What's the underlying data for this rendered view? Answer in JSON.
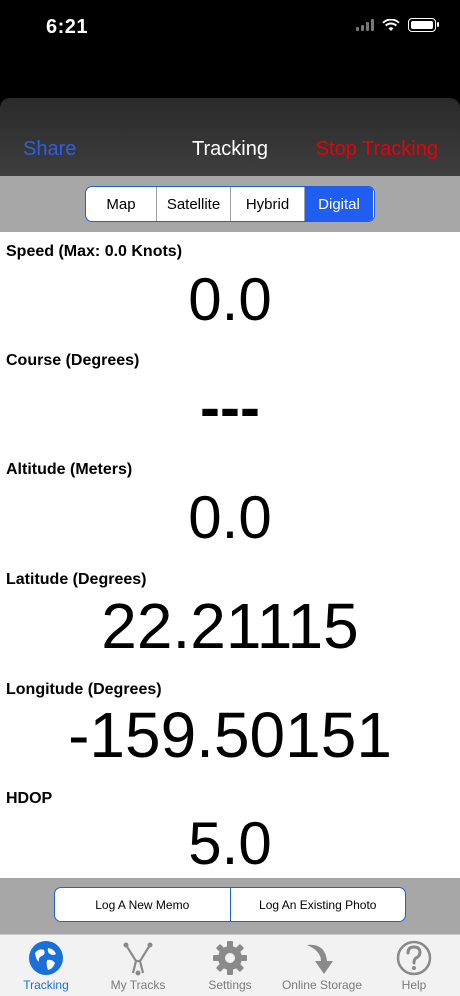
{
  "status_bar": {
    "time": "6:21"
  },
  "nav": {
    "left": "Share",
    "title": "Tracking",
    "right": "Stop Tracking"
  },
  "segments": [
    "Map",
    "Satellite",
    "Hybrid",
    "Digital"
  ],
  "selected_segment": "Digital",
  "readouts": [
    {
      "label": "Speed (Max: 0.0 Knots)",
      "value": "0.0"
    },
    {
      "label": "Course (Degrees)",
      "value": "---"
    },
    {
      "label": "Altitude (Meters)",
      "value": "0.0"
    },
    {
      "label": "Latitude (Degrees)",
      "value": "22.21115"
    },
    {
      "label": "Longitude (Degrees)",
      "value": "-159.50151"
    },
    {
      "label": "HDOP",
      "value": "5.0"
    }
  ],
  "memo": {
    "new_memo": "Log A New Memo",
    "existing_photo": "Log An Existing Photo"
  },
  "tabs": [
    {
      "label": "Tracking",
      "icon": "globe-icon"
    },
    {
      "label": "My Tracks",
      "icon": "tracks-icon"
    },
    {
      "label": "Settings",
      "icon": "gear-icon"
    },
    {
      "label": "Online Storage",
      "icon": "download-arrow-icon"
    },
    {
      "label": "Help",
      "icon": "question-icon"
    }
  ],
  "active_tab": "Tracking",
  "colors": {
    "accent": "#1f5ef0",
    "stop": "#e8000b",
    "nav_link": "#2d5fe0"
  }
}
